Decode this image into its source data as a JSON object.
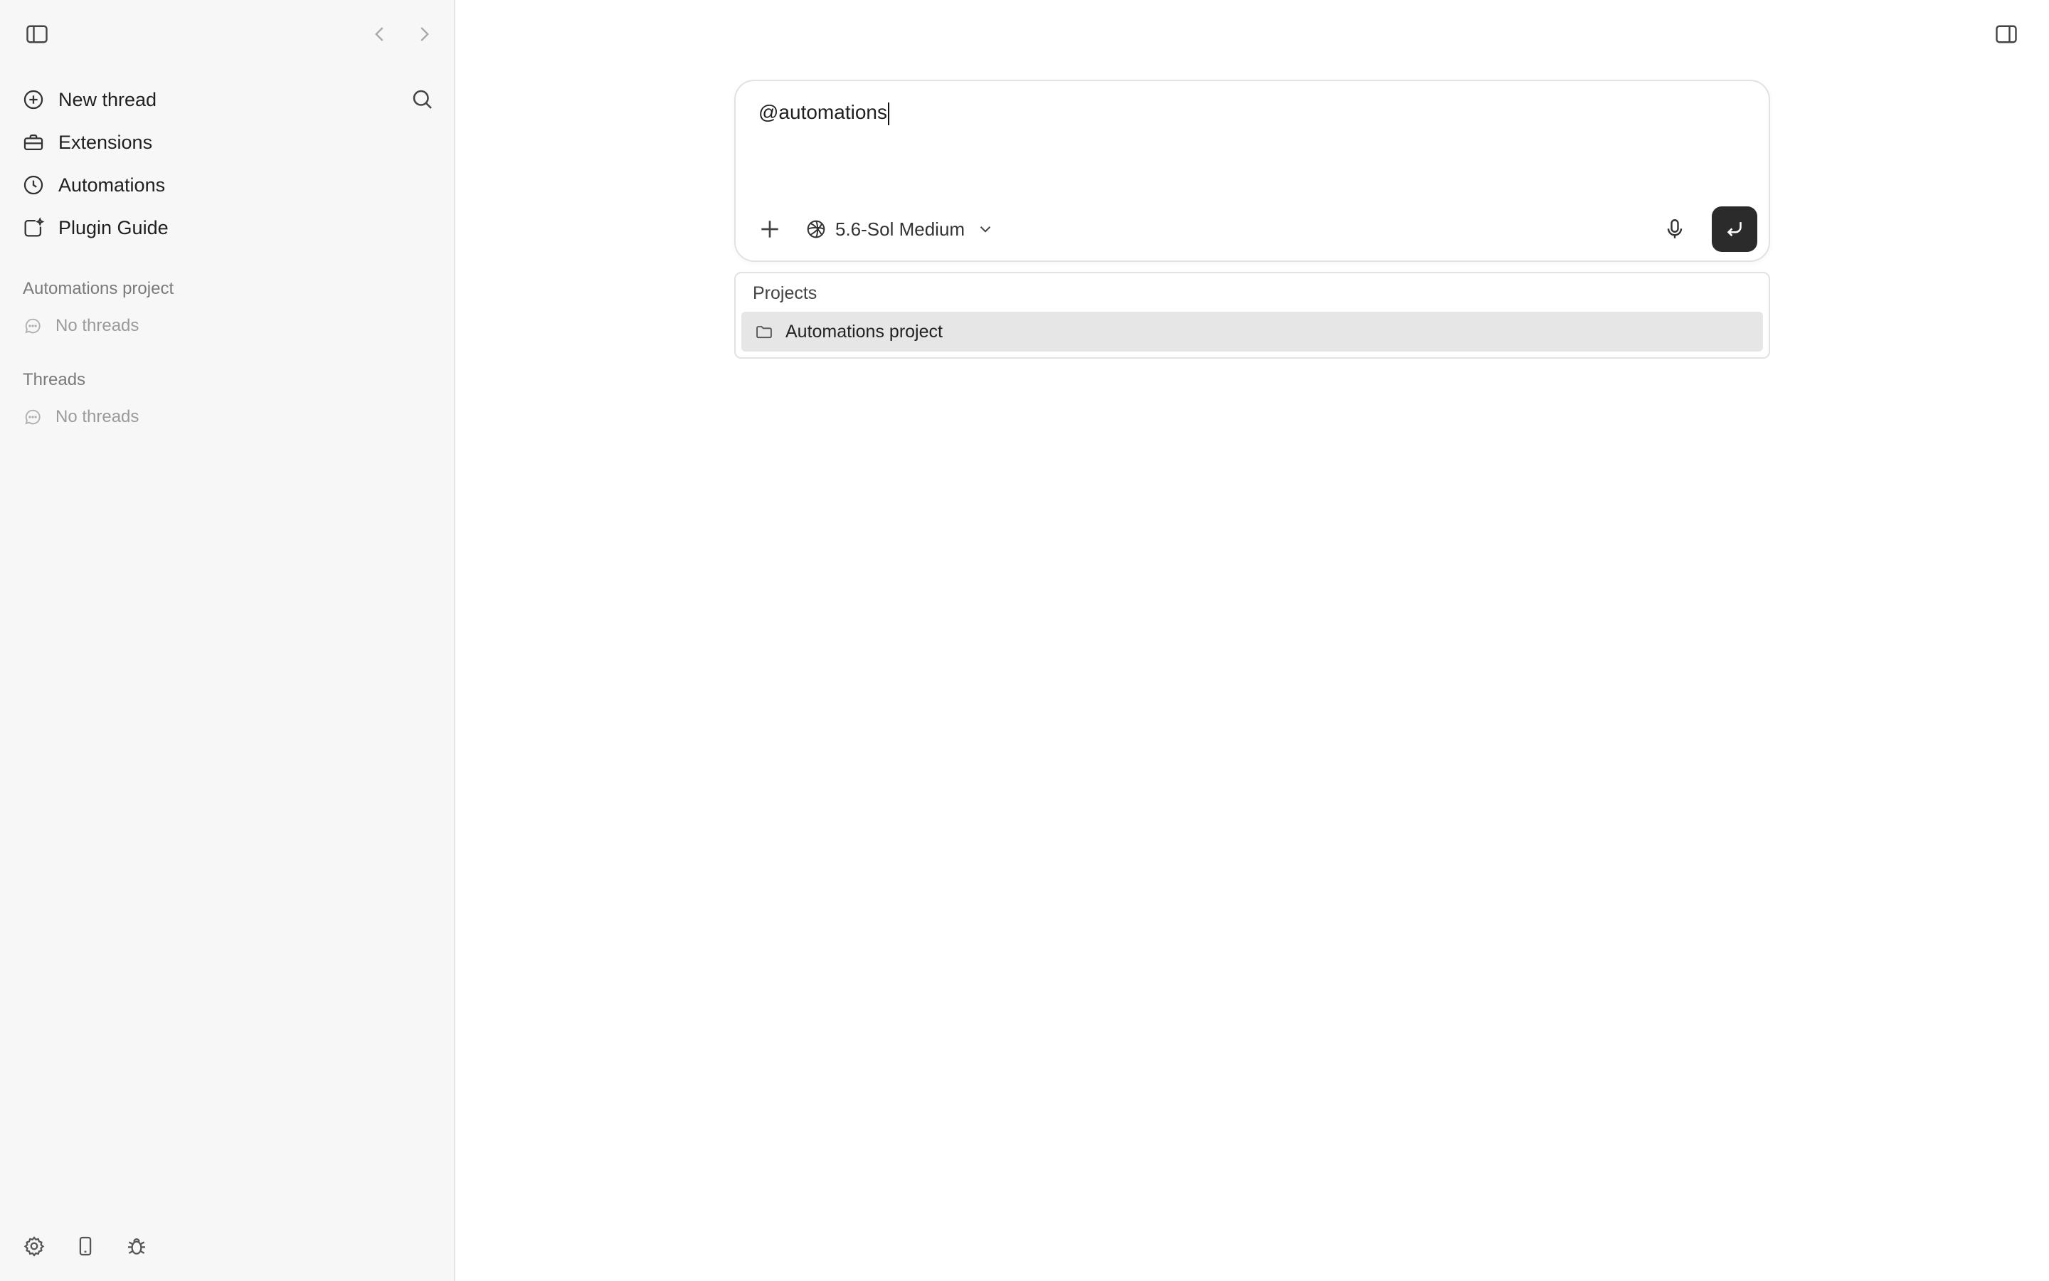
{
  "sidebar": {
    "nav": [
      {
        "label": "New thread",
        "icon": "plus-circle-icon"
      },
      {
        "label": "Extensions",
        "icon": "toolbox-icon"
      },
      {
        "label": "Automations",
        "icon": "clock-icon"
      },
      {
        "label": "Plugin Guide",
        "icon": "plugin-guide-icon"
      }
    ],
    "sections": [
      {
        "label": "Automations project",
        "empty_text": "No threads"
      },
      {
        "label": "Threads",
        "empty_text": "No threads"
      }
    ]
  },
  "composer": {
    "input_value": "@automations",
    "model_label": "5.6-Sol Medium"
  },
  "dropdown": {
    "header": "Projects",
    "items": [
      {
        "label": "Automations project",
        "icon": "folder-icon",
        "highlighted": true
      }
    ]
  }
}
